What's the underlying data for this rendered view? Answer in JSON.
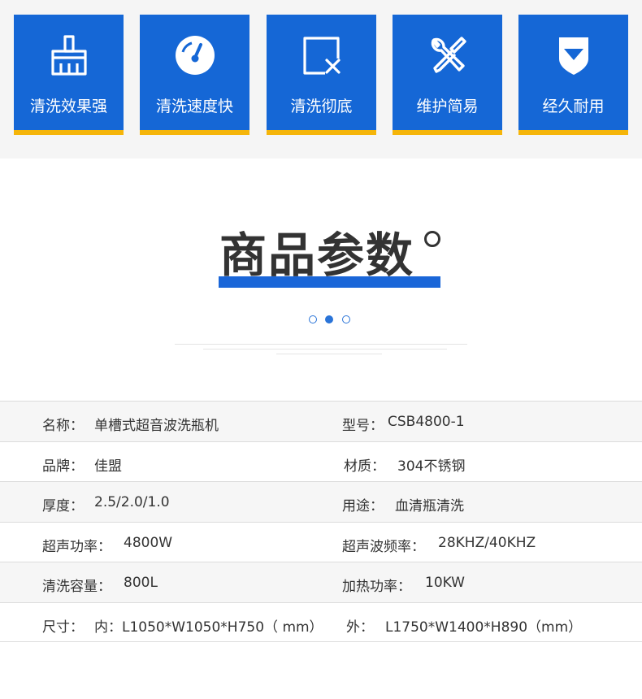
{
  "features": [
    {
      "icon": "brush-icon",
      "label": "清洗效果强"
    },
    {
      "icon": "speedometer-icon",
      "label": "清洗速度快"
    },
    {
      "icon": "window-close-icon",
      "label": "清洗彻底"
    },
    {
      "icon": "wrench-screwdriver-icon",
      "label": "维护简易"
    },
    {
      "icon": "shield-icon",
      "label": "经久耐用"
    }
  ],
  "section": {
    "title": "商品参数"
  },
  "specs": {
    "rows": [
      {
        "left_label": "名称：",
        "left_value": "单槽式超音波洗瓶机",
        "right_label": "型号：",
        "right_value": "CSB4800-1"
      },
      {
        "left_label": "品牌：",
        "left_value": "佳盟",
        "right_label": "材质：",
        "right_value": "304不锈钢"
      },
      {
        "left_label": "厚度：",
        "left_value": "2.5/2.0/1.0",
        "right_label": "用途：",
        "right_value": "血清瓶清洗"
      },
      {
        "left_label": "超声功率：",
        "left_value": "4800W",
        "right_label": "超声波频率：",
        "right_value": "28KHZ/40KHZ"
      },
      {
        "left_label": "清洗容量：",
        "left_value": "800L",
        "right_label": "加热功率：",
        "right_value": "10KW"
      },
      {
        "left_label": "尺寸：",
        "left_value": "内：L1050*W1050*H750（ mm）",
        "right_label": "外：",
        "right_value": "L1750*W1400*H890（mm）"
      }
    ]
  },
  "colors": {
    "accent": "#1567d6",
    "underline": "#f5b50a"
  }
}
